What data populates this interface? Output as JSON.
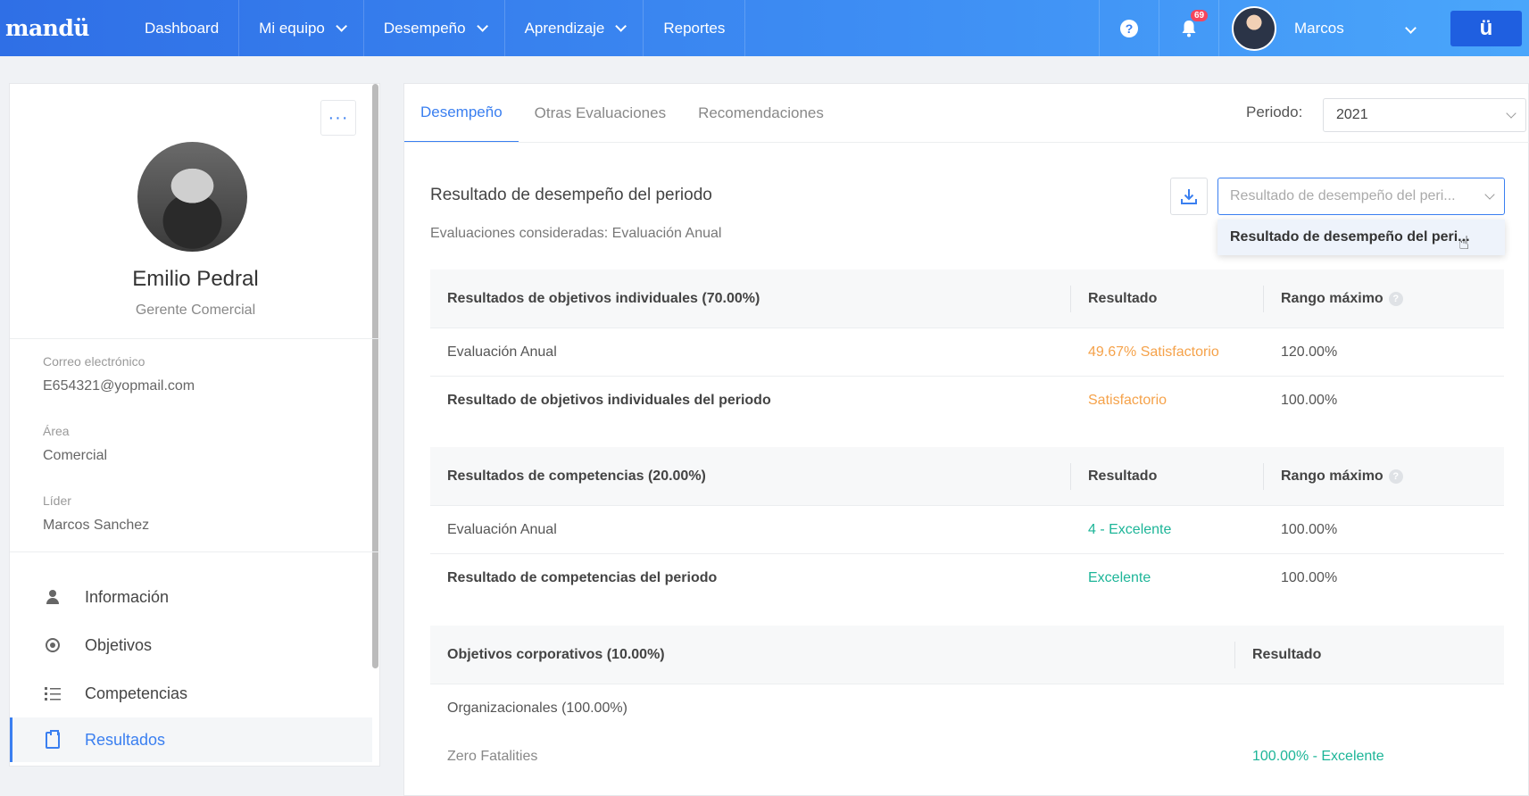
{
  "topbar": {
    "logo": "mandü",
    "nav": [
      {
        "label": "Dashboard",
        "has_menu": false
      },
      {
        "label": "Mi equipo",
        "has_menu": true
      },
      {
        "label": "Desempeño",
        "has_menu": true
      },
      {
        "label": "Aprendizaje",
        "has_menu": true
      },
      {
        "label": "Reportes",
        "has_menu": false
      }
    ],
    "help_icon": "?",
    "notifications_count": "69",
    "user_name": "Marcos",
    "brand_button": "ü",
    "accent_color": "#3a7ff0"
  },
  "profile": {
    "more_button": "···",
    "name": "Emilio Pedral",
    "role": "Gerente Comercial",
    "email_label": "Correo electrónico",
    "email": "E654321@yopmail.com",
    "area_label": "Área",
    "area": "Comercial",
    "leader_label": "Líder",
    "leader": "Marcos Sanchez",
    "menu": [
      {
        "label": "Información",
        "icon": "person-icon"
      },
      {
        "label": "Objetivos",
        "icon": "target-icon"
      },
      {
        "label": "Competencias",
        "icon": "list-icon"
      },
      {
        "label": "Resultados",
        "icon": "clipboard-icon",
        "active": true
      }
    ]
  },
  "tabs": [
    {
      "label": "Desempeño",
      "active": true
    },
    {
      "label": "Otras Evaluaciones"
    },
    {
      "label": "Recomendaciones"
    }
  ],
  "periodo": {
    "label": "Periodo:",
    "value": "2021"
  },
  "results": {
    "title": "Resultado de desempeño del periodo",
    "subtitle": "Evaluaciones consideradas: Evaluación Anual",
    "select_placeholder": "Resultado de desempeño del peri...",
    "dropdown_option": "Resultado de desempeño del peri..."
  },
  "objetivos": {
    "header": "Resultados de objetivos individuales (70.00%)",
    "col_result": "Resultado",
    "col_max": "Rango máximo",
    "rows": [
      {
        "name": "Evaluación Anual",
        "result": "49.67% Satisfactorio",
        "max": "120.00%"
      },
      {
        "name": "Resultado de objetivos individuales del periodo",
        "result": "Satisfactorio",
        "max": "100.00%"
      }
    ]
  },
  "competencias": {
    "header": "Resultados de competencias (20.00%)",
    "col_result": "Resultado",
    "col_max": "Rango máximo",
    "rows": [
      {
        "name": "Evaluación Anual",
        "result": "4 - Excelente",
        "max": "100.00%"
      },
      {
        "name": "Resultado de competencias del periodo",
        "result": "Excelente",
        "max": "100.00%"
      }
    ]
  },
  "corporativos": {
    "header": "Objetivos corporativos (10.00%)",
    "col_result": "Resultado",
    "rows": [
      {
        "name": "Organizacionales (100.00%)",
        "result": ""
      },
      {
        "name": "Zero Fatalities",
        "result": "100.00% - Excelente"
      }
    ]
  }
}
